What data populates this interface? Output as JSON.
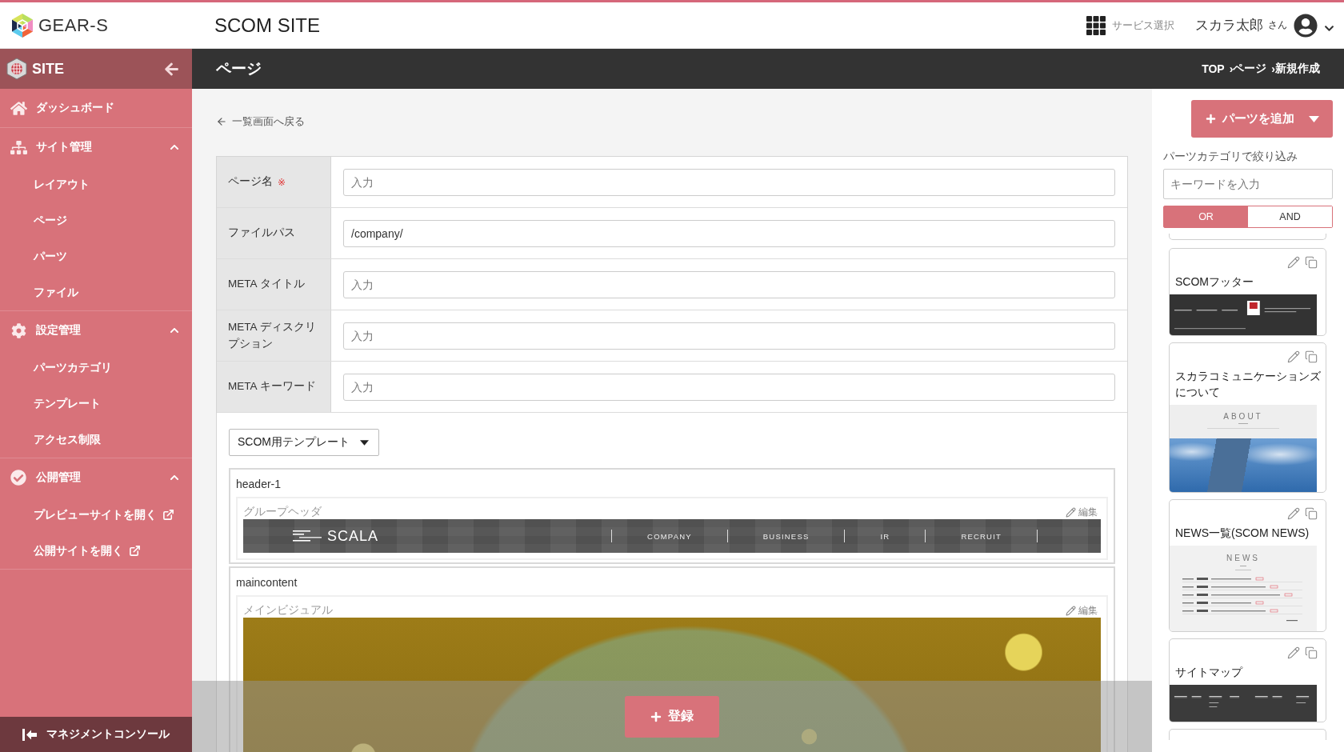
{
  "header": {
    "logo": "GEAR-S",
    "site_title": "SCOM SITE",
    "service_menu": "サービス選択",
    "user_name": "スカラ太郎",
    "honorific": "さん"
  },
  "sidebar": {
    "title": "SITE",
    "items": [
      {
        "kind": "link",
        "label": "ダッシュボード"
      },
      {
        "kind": "section",
        "label": "サイト管理",
        "expanded": true,
        "children": [
          {
            "label": "レイアウト",
            "external": false
          },
          {
            "label": "ページ",
            "external": false
          },
          {
            "label": "パーツ",
            "external": false
          },
          {
            "label": "ファイル",
            "external": false
          }
        ]
      },
      {
        "kind": "section",
        "label": "設定管理",
        "expanded": true,
        "children": [
          {
            "label": "パーツカテゴリ",
            "external": false
          },
          {
            "label": "テンプレート",
            "external": false
          },
          {
            "label": "アクセス制限",
            "external": false
          }
        ]
      },
      {
        "kind": "section",
        "label": "公開管理",
        "expanded": true,
        "children": [
          {
            "label": "プレビューサイトを開く",
            "external": true
          },
          {
            "label": "公開サイトを開く",
            "external": true
          }
        ]
      }
    ],
    "footer": "マネジメントコンソール"
  },
  "page_bar": {
    "title": "ページ",
    "breadcrumb": [
      "TOP",
      "ページ",
      "新規作成"
    ],
    "separator": "›"
  },
  "form": {
    "back_link": "一覧画面へ戻る",
    "required_mark": "※",
    "fields": [
      {
        "label": "ページ名",
        "required": true,
        "placeholder": "入力"
      },
      {
        "label": "ファイルパス",
        "required": false,
        "value": "/company/"
      },
      {
        "label": "META タイトル",
        "required": false,
        "placeholder": "入力"
      },
      {
        "label": "META ディスクリプション",
        "required": false,
        "placeholder": "入力"
      },
      {
        "label": "META キーワード",
        "required": false,
        "placeholder": "入力"
      }
    ],
    "template_select": "SCOM用テンプレート",
    "areas": [
      {
        "name": "header-1",
        "parts": [
          {
            "kind": "header",
            "name": "グループヘッダ",
            "edit": "編集",
            "logo": "SCALA",
            "nav": [
              "COMPANY",
              "BUSINESS",
              "IR",
              "RECRUIT"
            ]
          }
        ]
      },
      {
        "name": "maincontent",
        "parts": [
          {
            "kind": "photo",
            "name": "メインビジュアル",
            "edit": "編集"
          }
        ]
      }
    ],
    "submit": "登録"
  },
  "parts_panel": {
    "add_button": "パーツを追加",
    "filter_label": "パーツカテゴリで絞り込み",
    "keyword_placeholder": "キーワードを入力",
    "modes": [
      {
        "label": "OR",
        "selected": true
      },
      {
        "label": "AND",
        "selected": false
      }
    ],
    "cards": [
      {
        "kind": "footer",
        "title": "SCOMフッター"
      },
      {
        "kind": "about",
        "title": "スカラコミュニケーションズについて",
        "heading": "ABOUT"
      },
      {
        "kind": "news",
        "title": "NEWS一覧(SCOM NEWS)",
        "heading": "NEWS"
      },
      {
        "kind": "sitemap",
        "title": "サイトマップ"
      }
    ]
  }
}
